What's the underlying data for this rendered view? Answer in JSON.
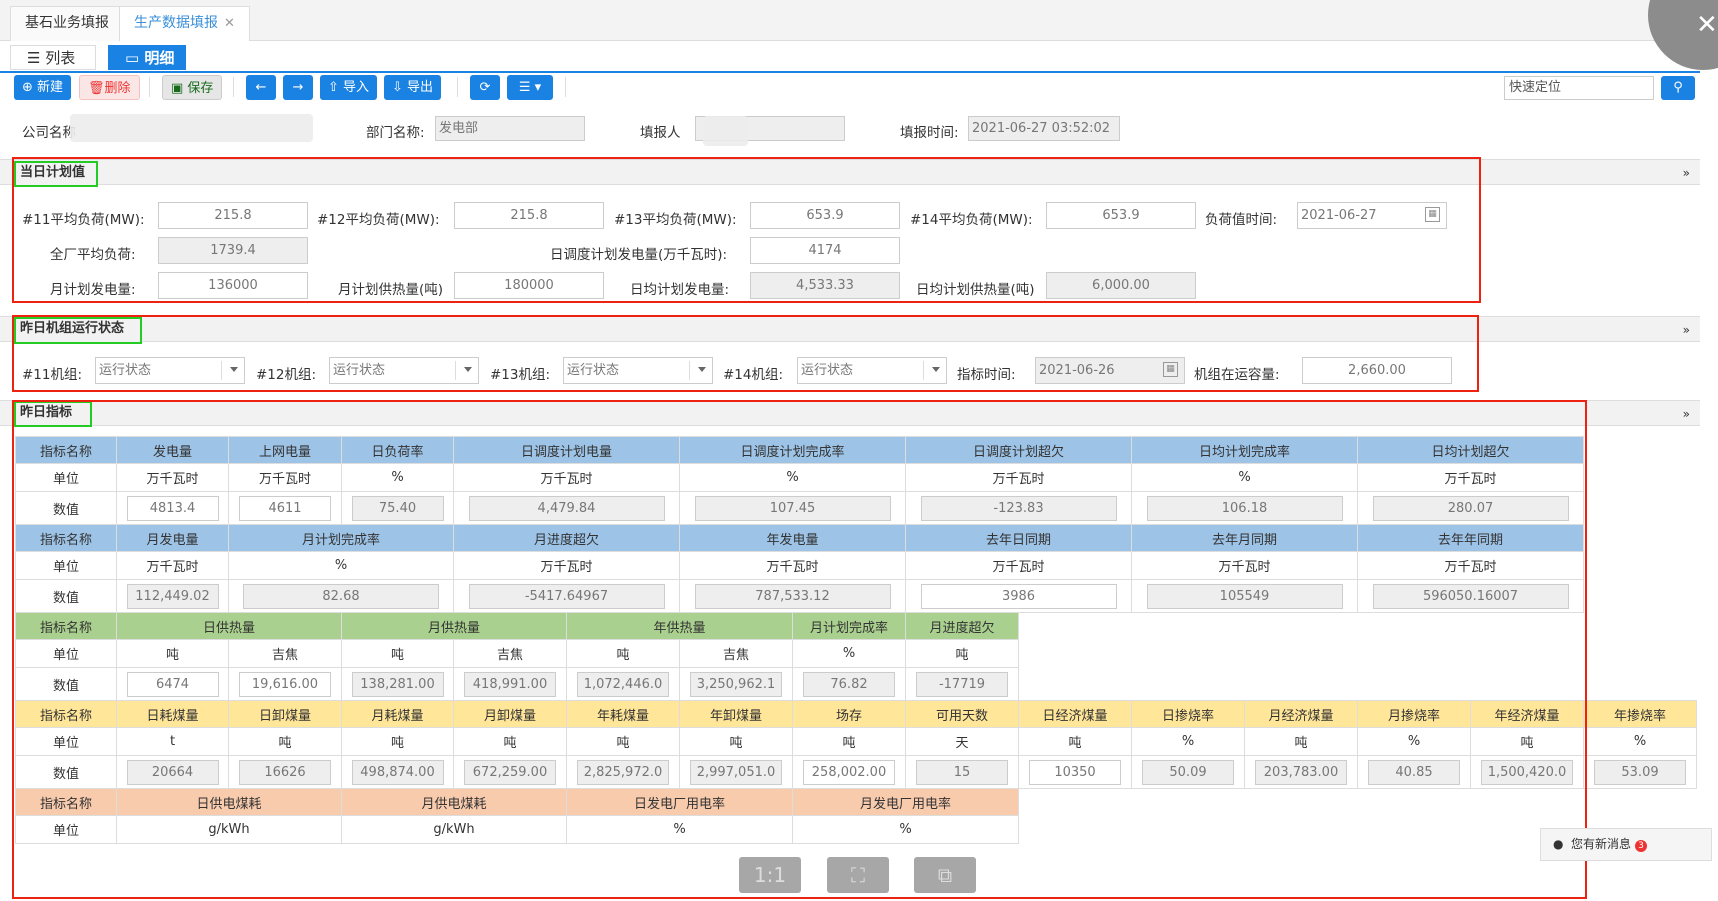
{
  "tabs": [
    {
      "label": "基石业务填报"
    },
    {
      "label": "生产数据填报",
      "close": "✕"
    }
  ],
  "view_tabs": {
    "list": "列表",
    "detail": "明细"
  },
  "toolbar": {
    "new": "新建",
    "delete": "删除",
    "save": "保存",
    "import": "导入",
    "export": "导出",
    "quick_locate": "快速定位"
  },
  "header": {
    "company_label": "公司名称",
    "dept_label": "部门名称:",
    "dept_value": "发电部",
    "reporter_label": "填报人",
    "time_label": "填报时间:",
    "time_value": "2021-06-27 03:52:02"
  },
  "plan": {
    "title": "当日计划值",
    "f1_label": "#11平均负荷(MW):",
    "f1": "215.8",
    "f2_label": "#12平均负荷(MW):",
    "f2": "215.8",
    "f3_label": "#13平均负荷(MW):",
    "f3": "653.9",
    "f4_label": "#14平均负荷(MW):",
    "f4": "653.9",
    "time_label": "负荷值时间:",
    "time": "2021-06-27",
    "plant_label": "全厂平均负荷:",
    "plant": "1739.4",
    "dispatch_label": "日调度计划发电量(万千瓦时):",
    "dispatch": "4174",
    "month_gen_label": "月计划发电量:",
    "month_gen": "136000",
    "month_heat_label": "月计划供热量(吨)",
    "month_heat": "180000",
    "day_avg_gen_label": "日均计划发电量:",
    "day_avg_gen": "4,533.33",
    "day_avg_heat_label": "日均计划供热量(吨)",
    "day_avg_heat": "6,000.00"
  },
  "units": {
    "title": "昨日机组运行状态",
    "u11_label": "#11机组:",
    "u12_label": "#12机组:",
    "u13_label": "#13机组:",
    "u14_label": "#14机组:",
    "placeholder": "运行状态",
    "time_label": "指标时间:",
    "time": "2021-06-26",
    "capacity_label": "机组在运容量:",
    "capacity": "2,660.00"
  },
  "indicators": {
    "title": "昨日指标",
    "row_name": "指标名称",
    "row_unit": "单位",
    "row_value": "数值",
    "g1": {
      "names": [
        "发电量",
        "上网电量",
        "日负荷率",
        "日调度计划电量",
        "日调度计划完成率",
        "日调度计划超欠",
        "日均计划完成率",
        "日均计划超欠"
      ],
      "units": [
        "万千瓦时",
        "万千瓦时",
        "%",
        "万千瓦时",
        "%",
        "万千瓦时",
        "%",
        "万千瓦时"
      ],
      "values": [
        "4813.4",
        "4611",
        "75.40",
        "4,479.84",
        "107.45",
        "-123.83",
        "106.18",
        "280.07"
      ]
    },
    "g2": {
      "names": [
        "月发电量",
        "月计划完成率",
        "月进度超欠",
        "年发电量",
        "去年日同期",
        "去年月同期",
        "去年年同期"
      ],
      "units": [
        "万千瓦时",
        "%",
        "万千瓦时",
        "万千瓦时",
        "万千瓦时",
        "万千瓦时",
        "万千瓦时"
      ],
      "values": [
        "112,449.02",
        "82.68",
        "-5417.64967",
        "787,533.12",
        "3986",
        "105549",
        "596050.16007"
      ]
    },
    "g3": {
      "names": [
        "日供热量",
        "月供热量",
        "年供热量",
        "月计划完成率",
        "月进度超欠"
      ],
      "units": [
        "吨",
        "吉焦",
        "吨",
        "吉焦",
        "吨",
        "吉焦",
        "%",
        "吨"
      ],
      "values": [
        "6474",
        "19,616.00",
        "138,281.00",
        "418,991.00",
        "1,072,446.0",
        "3,250,962.1",
        "76.82",
        "-17719"
      ]
    },
    "g4": {
      "names": [
        "日耗煤量",
        "日卸煤量",
        "月耗煤量",
        "月卸煤量",
        "年耗煤量",
        "年卸煤量",
        "场存",
        "可用天数",
        "日经济煤量",
        "日掺烧率",
        "月经济煤量",
        "月掺烧率",
        "年经济煤量",
        "年掺烧率"
      ],
      "units": [
        "t",
        "吨",
        "吨",
        "吨",
        "吨",
        "吨",
        "吨",
        "天",
        "吨",
        "%",
        "吨",
        "%",
        "吨",
        "%"
      ],
      "values": [
        "20664",
        "16626",
        "498,874.00",
        "672,259.00",
        "2,825,972.0",
        "2,997,051.0",
        "258,002.00",
        "15",
        "10350",
        "50.09",
        "203,783.00",
        "40.85",
        "1,500,420.0",
        "53.09"
      ]
    },
    "g5": {
      "names": [
        "日供电煤耗",
        "月供电煤耗",
        "日发电厂用电率",
        "月发电厂用电率"
      ],
      "units": [
        "g/kWh",
        "g/kWh",
        "%",
        "%"
      ]
    }
  },
  "message": {
    "text": "您有新消息",
    "count": "3"
  },
  "float_bar": {
    "ratio": "1:1"
  },
  "colors": {
    "primary": "#1a82e2",
    "blue_header": "#9dc3e6",
    "green_header": "#a9d08e",
    "yellow_header": "#ffe699",
    "orange_header": "#f8cbad",
    "highlight_red": "#e21",
    "highlight_green": "#2c2"
  }
}
